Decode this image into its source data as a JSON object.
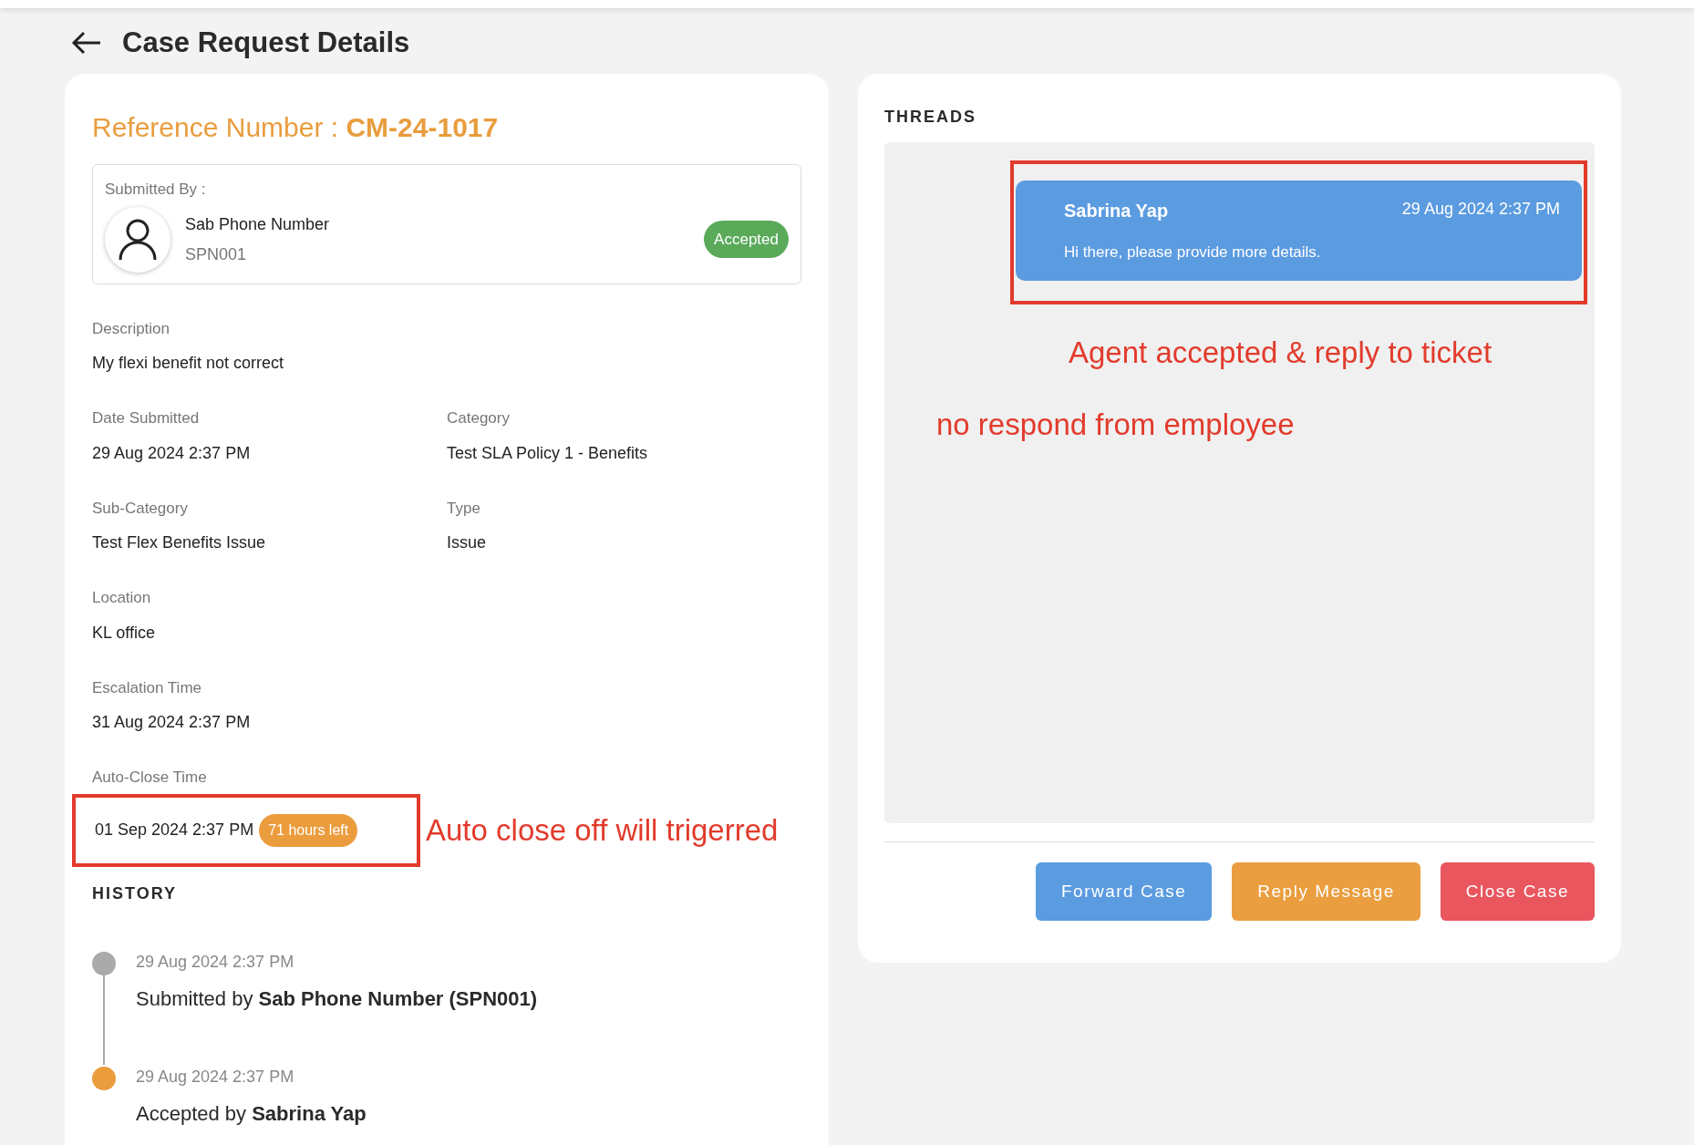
{
  "page_title": "Case Request Details",
  "reference": {
    "label": "Reference Number : ",
    "value": "CM-24-1017"
  },
  "submitted_by": {
    "label": "Submitted By :",
    "name": "Sab Phone Number",
    "id": "SPN001",
    "status": {
      "label": "Accepted",
      "color": "#5aaa5a"
    }
  },
  "field_rows": [
    [
      {
        "label": "Description",
        "value": "My flexi benefit not correct"
      }
    ],
    [
      {
        "label": "Date Submitted",
        "value": "29 Aug 2024 2:37 PM"
      },
      {
        "label": "Category",
        "value": "Test SLA Policy 1 - Benefits"
      }
    ],
    [
      {
        "label": "Sub-Category",
        "value": "Test Flex Benefits Issue"
      },
      {
        "label": "Type",
        "value": "Issue"
      }
    ],
    [
      {
        "label": "Location",
        "value": "KL office"
      }
    ],
    [
      {
        "label": "Escalation Time",
        "value": "31 Aug 2024 2:37 PM"
      }
    ]
  ],
  "auto_close": {
    "label": "Auto-Close Time",
    "value": "01 Sep 2024 2:37 PM",
    "badge": "71 hours left",
    "highlighted": true,
    "annotation": "Auto close off will trigerred"
  },
  "history": {
    "title": "HISTORY",
    "items": [
      {
        "time": "29 Aug 2024 2:37 PM",
        "text": "Submitted by **Sab Phone Number (SPN001)**",
        "color": "#aaaaaa"
      },
      {
        "time": "29 Aug 2024 2:37 PM",
        "text": "Accepted by **Sabrina Yap**",
        "color": "#eb9c3d"
      }
    ]
  },
  "threads": {
    "title": "THREADS",
    "messages": [
      {
        "sender": "Sabrina Yap",
        "time": "29 Aug 2024 2:37 PM",
        "text": "Hi there, please provide more details.",
        "highlighted": true
      }
    ],
    "annotations": [
      "Agent accepted & reply to ticket",
      "no respond from employee"
    ]
  },
  "buttons": [
    {
      "label": "Forward Case",
      "color": "#5b9be0"
    },
    {
      "label": "Reply Message",
      "color": "#ea9e3f"
    },
    {
      "label": "Close Case",
      "color": "#e9565e"
    }
  ]
}
